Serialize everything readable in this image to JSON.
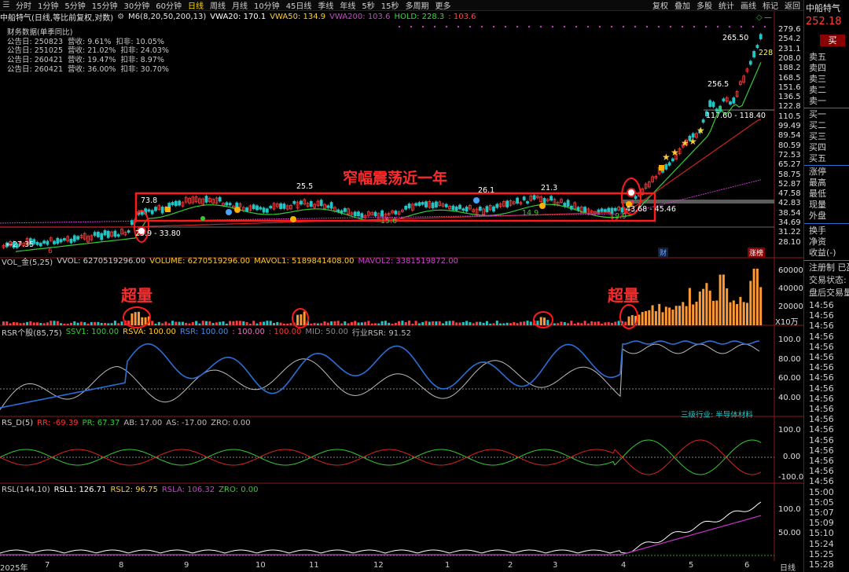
{
  "topbar": {
    "periods": [
      "分时",
      "1分钟",
      "5分钟",
      "15分钟",
      "30分钟",
      "60分钟",
      "日线",
      "周线",
      "月线",
      "10分钟",
      "45日线",
      "季线",
      "年线",
      "5秒",
      "15秒",
      "多周期",
      "更多"
    ],
    "active": "日线",
    "right_buttons": [
      "复权",
      "叠加",
      "多股",
      "统计",
      "画线",
      "标记",
      "返回"
    ]
  },
  "main_header": {
    "title": "中船特气(日线,等比前复权,对数)",
    "indicator": "M6(8,20,50,200,13)",
    "vwa20": "VWA20: 170.1",
    "vwa50": "VWA50: 134.9",
    "vwa200": "VWA200: 103.6",
    "hold": "HOLD: 228.3",
    "hold_extra": ": 103.6"
  },
  "financials": {
    "title": "财务数据(单季同比)",
    "rows": [
      {
        "date": "公告日: 250823",
        "rev": "营收: 9.61%",
        "net": "扣非: 10.05%"
      },
      {
        "date": "公告日: 251025",
        "rev": "营收: 21.02%",
        "net": "扣非: 24.03%"
      },
      {
        "date": "公告日: 260421",
        "rev": "营收: 19.47%",
        "net": "扣非: 8.97%"
      },
      {
        "date": "公告日: 260421",
        "rev": "营收: 36.00%",
        "net": "扣非: 30.70%"
      }
    ]
  },
  "price_axis": [
    "279.6",
    "254.2",
    "231.1",
    "208.0",
    "188.2",
    "168.5",
    "151.6",
    "136.5",
    "122.8",
    "110.5",
    "99.49",
    "89.54",
    "80.59",
    "72.53",
    "65.27",
    "58.75",
    "52.87",
    "47.58",
    "42.83",
    "38.54",
    "34.69",
    "31.22",
    "28.10"
  ],
  "chart_labels": {
    "box_title": "窄幅震荡近一年",
    "low_start": "27.35",
    "range_low": "29.9 - 33.80",
    "high1": "73.8",
    "high2": "25.5",
    "high3": "26.1",
    "high4": "21.3",
    "low1": "15.6",
    "low2": "14.9",
    "low3": "19.9",
    "range_right": "43.68 - 45.46",
    "mid_peak": "256.5",
    "range_upper": "117.60 - 118.40",
    "top_peak": "265.50",
    "hold_tag": "228",
    "tag_cai": "财",
    "tag_zb": "涨榜",
    "small_6": "6"
  },
  "vol_panel": {
    "title": "VOL_金(5,25)",
    "vvol": "VVOL: 6270519296.00",
    "volume": "VOLUME: 6270519296.00",
    "mavol1": "MAVOL1: 5189841408.00",
    "mavol2": "MAVOL2: 3381519872.00",
    "axis": [
      "60000",
      "40000",
      "20000"
    ],
    "unit": "X10万",
    "annot_left": "超量",
    "annot_right": "超量"
  },
  "rsr_panel": {
    "title": "RSR个股(85,75)",
    "ssv1": "SSV1: 100.00",
    "rsva": "RSVA: 100.00",
    "rsr": "RSR: 100.00",
    "r100a": ": 100.00",
    "r100b": ": 100.00",
    "mid": "MID: 50.00",
    "industry": "行业RSR: 91.52",
    "axis": [
      "100.0",
      "80.00",
      "60.00",
      "40.00"
    ],
    "industry_label": "三级行业: 半导体材料"
  },
  "rsd_panel": {
    "title": "RS_D(5)",
    "rr": "RR: -69.39",
    "pr": "PR: 67.37",
    "ab": "AB: 17.00",
    "as": "AS: -17.00",
    "zro": "ZRO: 0.00",
    "axis": [
      "100.0",
      "0.00",
      "-100.0"
    ]
  },
  "rsl_panel": {
    "title": "RSL(144,10)",
    "rsl1": "RSL1: 126.71",
    "rsl2": "RSL2: 96.75",
    "rsla": "RSLA: 106.32",
    "zro": "ZRO: 0.00",
    "axis": [
      "100.0",
      "50.00"
    ]
  },
  "x_axis": [
    "2025年",
    "7",
    "8",
    "9",
    "10",
    "11",
    "12",
    "1",
    "2",
    "3",
    "4",
    "5",
    "6"
  ],
  "x_axis_right": "日线",
  "right_panel": {
    "title": "中船特气",
    "price": "252.18",
    "buy_button": "买",
    "sell_levels": [
      "卖五",
      "卖四",
      "卖三",
      "卖二",
      "卖一"
    ],
    "buy_levels": [
      "买一",
      "买二",
      "买三",
      "买四",
      "买五"
    ],
    "stats": [
      "涨停",
      "最高",
      "最低",
      "现量",
      "外盘"
    ],
    "stats2": [
      "换手",
      "净资",
      "收益(-)"
    ],
    "reg": [
      "注册制 已盈",
      "交易状态: 盘",
      "盘后交易量"
    ],
    "times": [
      "14:56",
      "14:56",
      "14:56",
      "14:56",
      "14:56",
      "14:56",
      "14:56",
      "14:56",
      "14:56",
      "14:56",
      "14:56",
      "14:56",
      "14:56",
      "14:56",
      "14:56",
      "14:56",
      "14:56",
      "14:56",
      "15:00",
      "15:05",
      "15:07",
      "15:09",
      "15:10",
      "15:24",
      "15:25",
      "15:28"
    ]
  },
  "colors": {
    "up": "#ff3b3b",
    "down": "#23c4c4",
    "annotation": "#ff2020",
    "ma_green": "#33cc33",
    "ma_red": "#cc2222",
    "vwa50": "#ffcc33",
    "vwa200": "#cc33cc",
    "hold": "#33dd33",
    "vol_bar": "#ff9933"
  }
}
